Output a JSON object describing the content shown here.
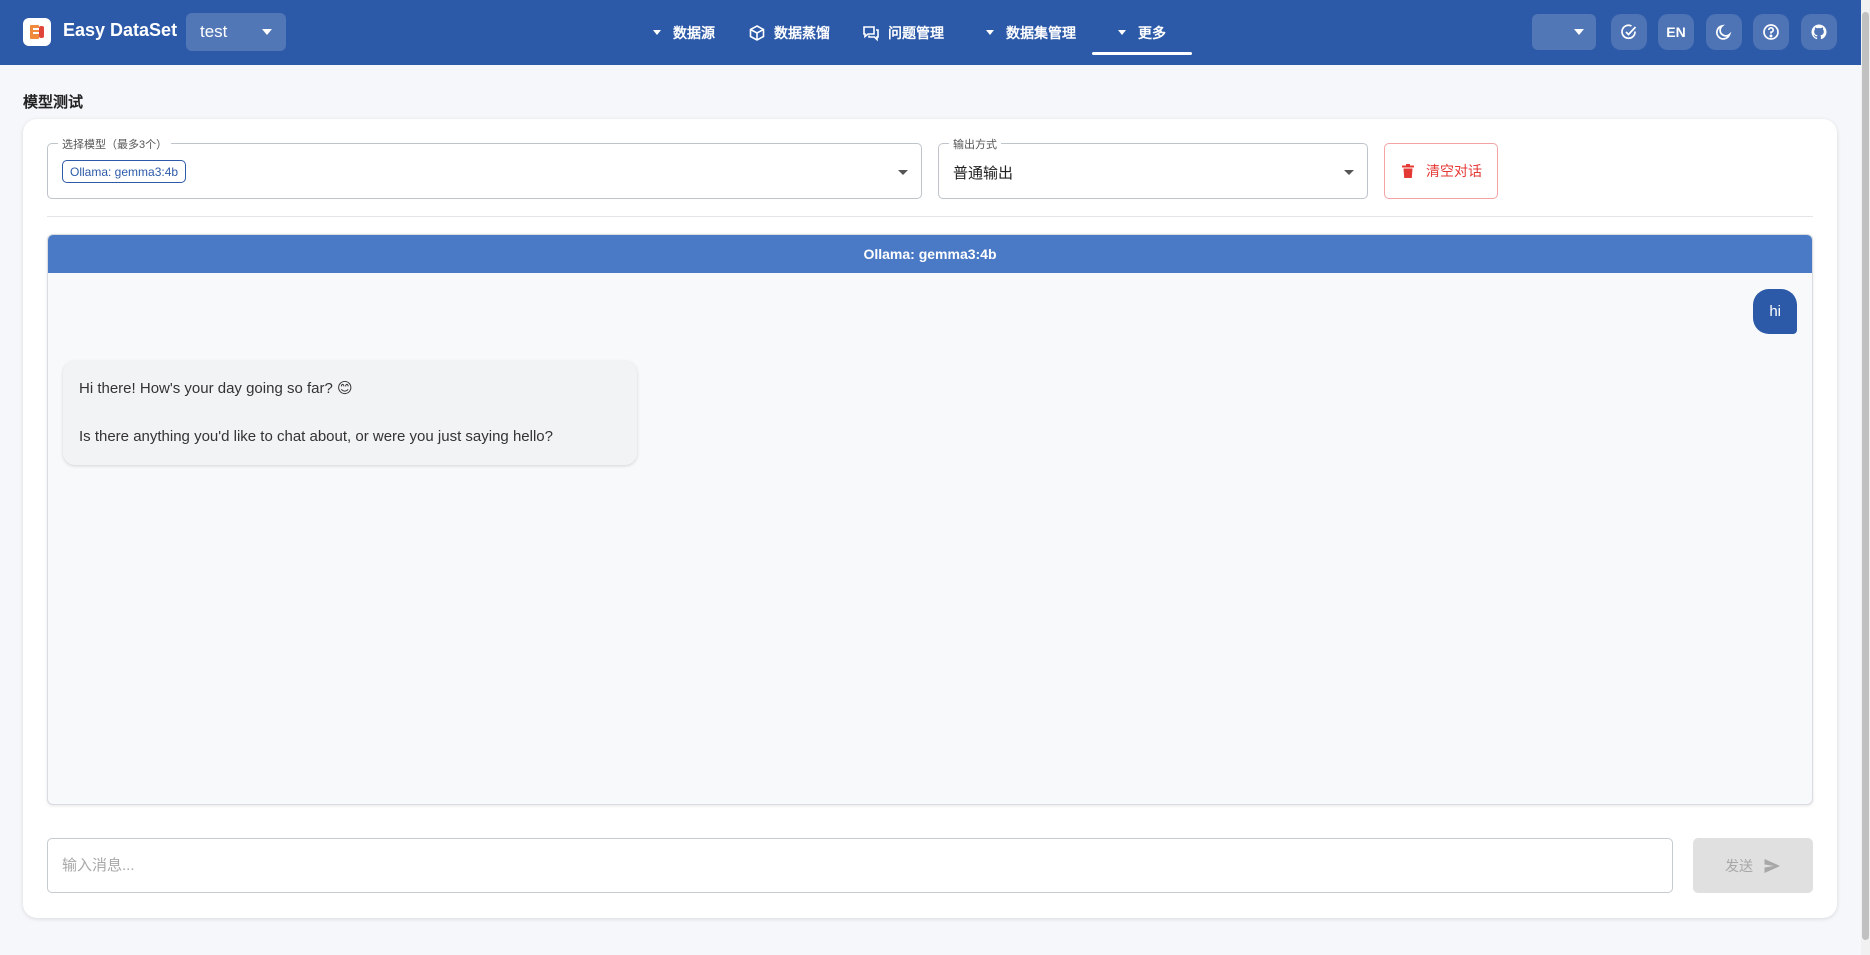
{
  "header": {
    "app_title": "Easy DataSet",
    "project": "test",
    "nav": [
      {
        "label": "数据源"
      },
      {
        "label": "数据蒸馏"
      },
      {
        "label": "问题管理"
      },
      {
        "label": "数据集管理"
      },
      {
        "label": "更多"
      }
    ],
    "lang_label": "EN"
  },
  "page": {
    "title": "模型测试"
  },
  "controls": {
    "model_legend": "选择模型（最多3个）",
    "model_chip": "Ollama: gemma3:4b",
    "output_legend": "输出方式",
    "output_value": "普通输出",
    "clear_label": "清空对话"
  },
  "chat": {
    "panel_title": "Ollama: gemma3:4b",
    "user_message": "hi",
    "bot_lines": [
      "Hi there! How's your day going so far? 😊",
      "Is there anything you'd like to chat about, or were you just saying hello?"
    ]
  },
  "composer": {
    "placeholder": "输入消息...",
    "send_label": "发送"
  },
  "colors": {
    "primary": "#2d5aa8",
    "panel_header": "#4a7ac6",
    "danger": "#e53935"
  }
}
